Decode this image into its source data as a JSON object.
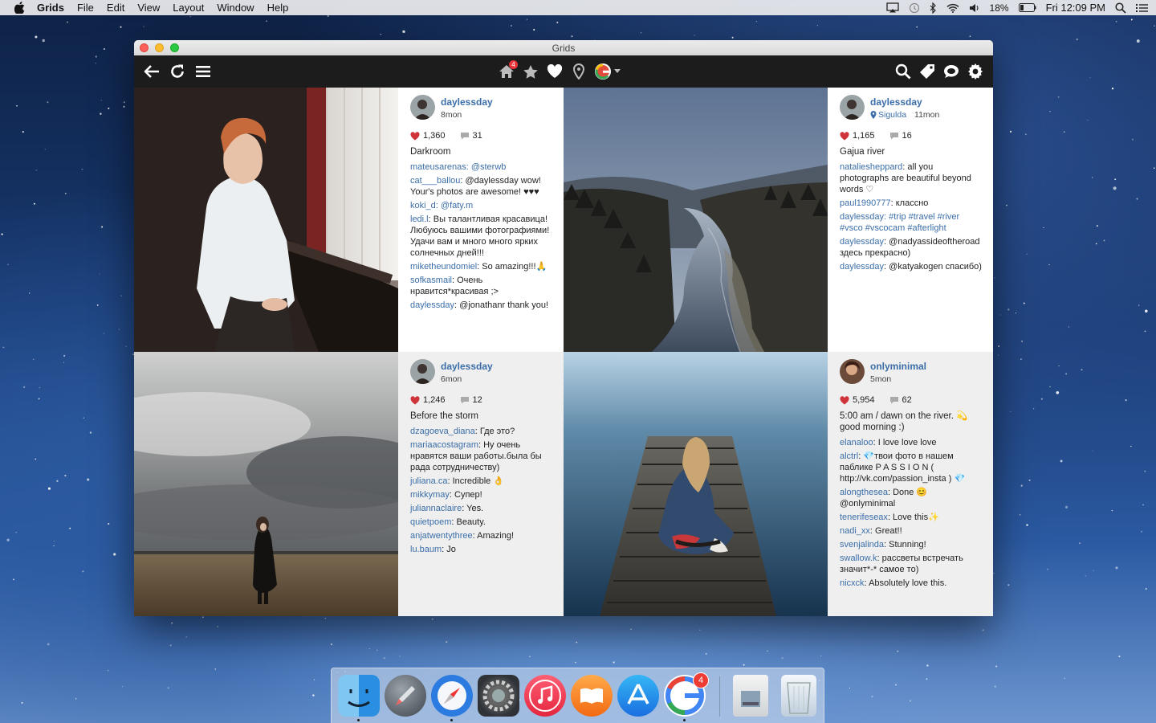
{
  "menubar": {
    "app_name": "Grids",
    "items": [
      "File",
      "Edit",
      "View",
      "Layout",
      "Window",
      "Help"
    ],
    "battery": "18%",
    "clock": "Fri 12:09 PM"
  },
  "window": {
    "title": "Grids",
    "home_badge": "4"
  },
  "posts": [
    {
      "user": "daylessday",
      "location": "",
      "age": "8mon",
      "likes": "1,360",
      "comments_count": "31",
      "caption": "Darkroom",
      "comments": [
        {
          "user": "mateusarenas",
          "text": ": @sterwb",
          "mention": true
        },
        {
          "user": "cat___ballou",
          "text": ": @daylessday wow! Your's photos are awesome! ♥♥♥"
        },
        {
          "user": "koki_d",
          "text": ": @faty.m",
          "mention": true
        },
        {
          "user": "ledi.l",
          "text": ": Вы талантливая красавица! Любуюсь вашими фотографиями! Удачи вам и много много ярких солнечных дней!!!"
        },
        {
          "user": "miketheundomiel",
          "text": ": So amazing!!!🙏"
        },
        {
          "user": "sofkasmail",
          "text": ": Очень нравится*красивая ;>"
        },
        {
          "user": "daylessday",
          "text": ": @jonathanr thank you!"
        }
      ]
    },
    {
      "user": "daylessday",
      "location": "Sigulda",
      "age": "11mon",
      "likes": "1,165",
      "comments_count": "16",
      "caption": "Gajua river",
      "comments": [
        {
          "user": "nataliesheppard",
          "text": ": all you photographs are beautiful beyond words ♡"
        },
        {
          "user": "paul1990777",
          "text": ": классно"
        },
        {
          "user": "daylessday",
          "text": ": #trip #travel #river #vsco #vscocam #afterlight",
          "mention": true
        },
        {
          "user": "daylessday",
          "text": ": @nadyassideoftheroad здесь прекрасно)"
        },
        {
          "user": "daylessday",
          "text": ": @katyakogen спасибо)"
        }
      ]
    },
    {
      "user": "daylessday",
      "location": "",
      "age": "6mon",
      "likes": "1,246",
      "comments_count": "12",
      "caption": "Before the storm",
      "comments": [
        {
          "user": "dzagoeva_diana",
          "text": ": Где это?"
        },
        {
          "user": "mariaacostagram",
          "text": ": Ну очень нравятся ваши работы.была бы рада сотрудничеству)"
        },
        {
          "user": "juliana.ca",
          "text": ": Incredible 👌"
        },
        {
          "user": "mikkymay",
          "text": ": Супер!"
        },
        {
          "user": "juliannaclaire",
          "text": ": Yes."
        },
        {
          "user": "quietpoem",
          "text": ": Beauty."
        },
        {
          "user": "anjatwentythree",
          "text": ": Amazing!"
        },
        {
          "user": "lu.baum",
          "text": ": Jo"
        }
      ]
    },
    {
      "user": "onlyminimal",
      "location": "",
      "age": "5mon",
      "likes": "5,954",
      "comments_count": "62",
      "caption": "5:00 am / dawn on the river. 💫 good morning :)",
      "comments": [
        {
          "user": "elanaloo",
          "text": ": I love love love"
        },
        {
          "user": "alctrl",
          "text": ": 💎твои фото в нашем паблике P A S S I O N ( http://vk.com/passion_insta ) 💎"
        },
        {
          "user": "alongthesea",
          "text": ": Done 😊 @onlyminimal"
        },
        {
          "user": "tenerifeseax",
          "text": ": Love this✨"
        },
        {
          "user": "nadi_xx",
          "text": ": Great!!"
        },
        {
          "user": "svenjalinda",
          "text": ": Stunning!"
        },
        {
          "user": "swallow.k",
          "text": ": рассветы встречать значит*-* самое то)"
        },
        {
          "user": "nicxck",
          "text": ": Absolutely love this."
        }
      ]
    }
  ],
  "dock": {
    "badge": "4",
    "apps": [
      "finder-icon",
      "launchpad-icon",
      "safari-icon",
      "system-preferences-icon",
      "itunes-icon",
      "ibooks-icon",
      "app-store-icon",
      "grids-icon",
      "preview-icon",
      "trash-icon"
    ]
  }
}
